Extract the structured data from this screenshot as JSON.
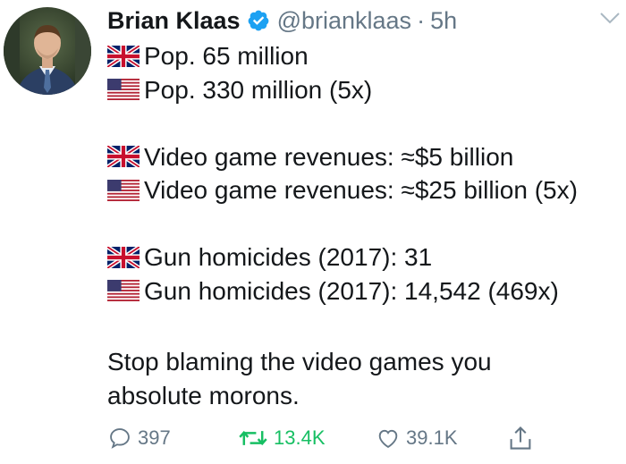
{
  "tweet": {
    "author": {
      "name": "Brian Klaas",
      "handle": "@brianklaas",
      "verified": true,
      "avatar_icon": "profile-photo"
    },
    "separator": "·",
    "time": "5h",
    "lines": [
      {
        "flag": "uk-flag-icon",
        "text": "Pop. 65 million"
      },
      {
        "flag": "us-flag-icon",
        "text": "Pop. 330 million (5x)"
      },
      {
        "flag": "uk-flag-icon",
        "text": "Video game revenues: ≈$5 billion"
      },
      {
        "flag": "us-flag-icon",
        "text": "Video game revenues: ≈$25 billion (5x)"
      },
      {
        "flag": "uk-flag-icon",
        "text": "Gun homicides (2017): 31"
      },
      {
        "flag": "us-flag-icon",
        "text": "Gun homicides (2017): 14,542 (469x)"
      }
    ],
    "closing": "Stop blaming the video games you absolute morons.",
    "actions": {
      "replies": "397",
      "retweets": "13.4K",
      "likes": "39.1K"
    },
    "colors": {
      "text": "#14171a",
      "muted": "#657786",
      "retweet": "#17bf63",
      "verified": "#1da1f2"
    }
  }
}
